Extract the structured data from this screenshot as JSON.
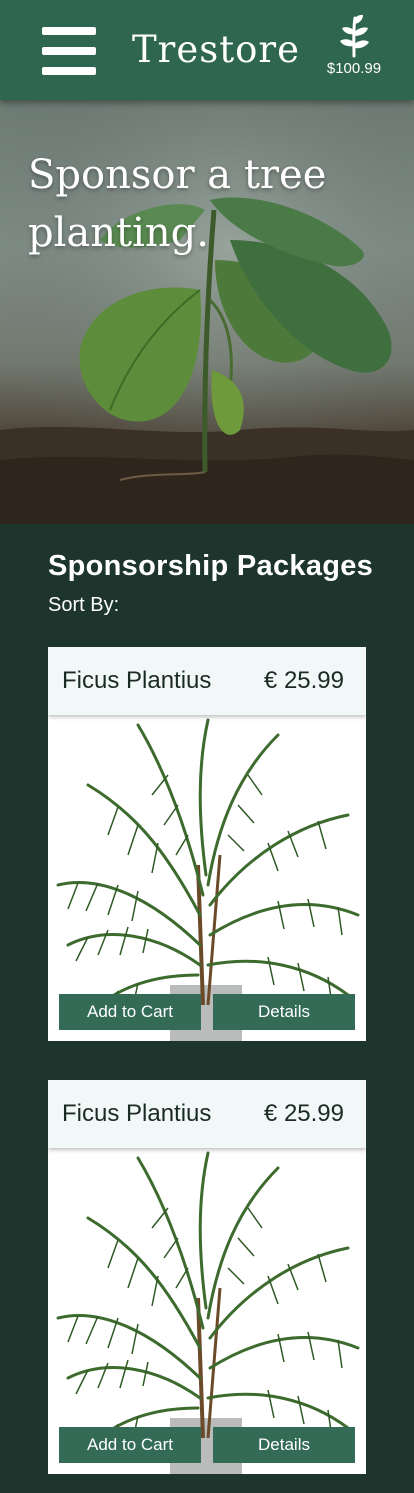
{
  "header": {
    "brand": "Trestore",
    "menu_icon": "hamburger-menu-icon",
    "cart_icon": "leaf-sprig-icon",
    "cart_total": "$100.99",
    "bar_color": "#2f6650"
  },
  "hero": {
    "title": "Sponsor a tree planting."
  },
  "section": {
    "title": "Sponsorship Packages",
    "sort_label": "Sort By:"
  },
  "products": [
    {
      "name": "Ficus Plantius",
      "price": "€ 25.99",
      "add_label": "Add to Cart",
      "details_label": "Details"
    },
    {
      "name": "Ficus Plantius",
      "price": "€ 25.99",
      "add_label": "Add to Cart",
      "details_label": "Details"
    }
  ],
  "colors": {
    "page_bg": "#1d352d",
    "button_bg": "#336b57",
    "card_head_bg": "#f2f7f7"
  }
}
